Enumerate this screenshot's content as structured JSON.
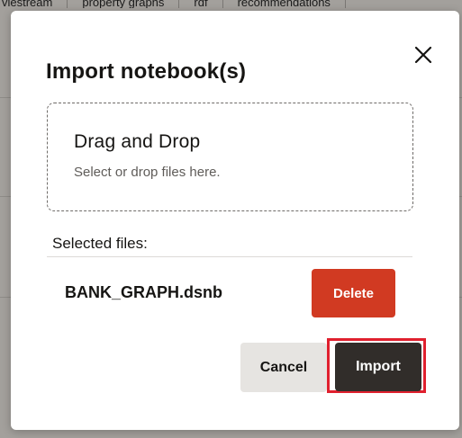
{
  "background": {
    "tabs": [
      "viestream",
      "property graphs",
      "rdf",
      "recommendations"
    ]
  },
  "dialog": {
    "title": "Import notebook(s)",
    "close_icon": "close-icon",
    "drop_zone": {
      "title": "Drag and Drop",
      "subtitle": "Select or drop files here."
    },
    "selected_files_label": "Selected files:",
    "files": [
      {
        "name": "BANK_GRAPH.dsnb",
        "delete_label": "Delete"
      }
    ],
    "cancel_label": "Cancel",
    "import_label": "Import"
  },
  "colors": {
    "delete": "#d13a22",
    "import": "#312d2a",
    "highlight": "#e0202e",
    "cancel": "#e6e4e1"
  }
}
